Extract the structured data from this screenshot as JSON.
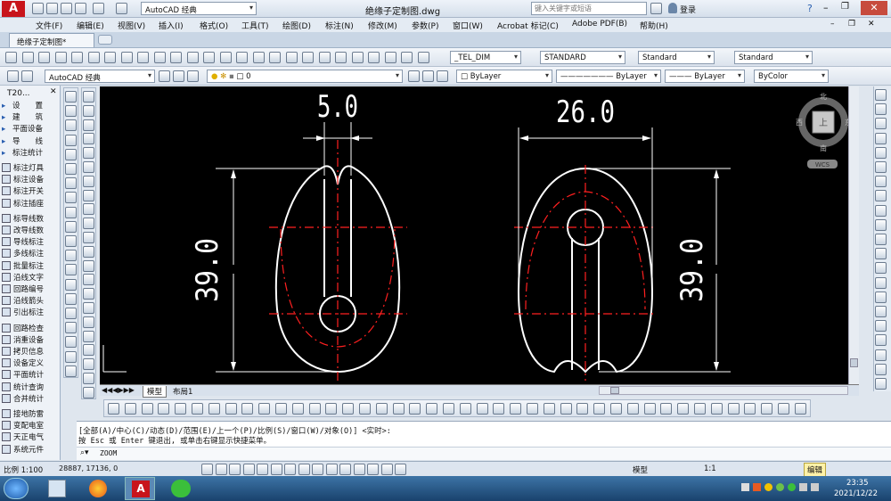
{
  "title_bar": {
    "workspace": "AutoCAD 经典",
    "file_title": "绝缘子定制图.dwg",
    "search_placeholder": "键入关键字或短语",
    "login": "登录"
  },
  "menu": [
    "文件(F)",
    "编辑(E)",
    "视图(V)",
    "插入(I)",
    "格式(O)",
    "工具(T)",
    "绘图(D)",
    "标注(N)",
    "修改(M)",
    "参数(P)",
    "窗口(W)",
    "Acrobat 标记(C)",
    "Adobe PDF(B)",
    "帮助(H)"
  ],
  "doc_tab": "绝缘子定制图*",
  "styles": {
    "dim_style": "_TEL_DIM",
    "text_style": "STANDARD",
    "table_style": "Standard",
    "multileader_style": "Standard"
  },
  "layers": {
    "workspace": "AutoCAD 经典",
    "layer": "0",
    "color": "ByLayer",
    "linetype": "ByLayer",
    "lineweight": "ByLayer",
    "plot": "ByColor"
  },
  "tangent_panel": {
    "title": "T20...",
    "items": [
      "设　　置",
      "建　　筑",
      "平面设备",
      "导　　线",
      "标注统计",
      "标注灯具",
      "标注设备",
      "标注开关",
      "标注插座",
      "标导线数",
      "改导线数",
      "导线标注",
      "多线标注",
      "批量标注",
      "沿线文字",
      "回路编号",
      "沿线箭头",
      "引出标注",
      "回路检查",
      "消重设备",
      "拷贝信息",
      "设备定义",
      "平面统计",
      "统计查询",
      "合并统计",
      "接地防雷",
      "变配电室",
      "天正电气",
      "系统元件"
    ]
  },
  "drawing": {
    "left_width_dim": "5.0",
    "left_height_dim": "39.0",
    "right_width_dim": "26.0",
    "right_height_dim": "39.0",
    "line_color": "#ffffff",
    "center_color": "#ff2020"
  },
  "viewcube": {
    "north": "北",
    "south": "南",
    "east": "东",
    "west": "西",
    "top": "上",
    "wcs": "WCS"
  },
  "layout_tabs": [
    "模型",
    "布局1"
  ],
  "command": {
    "line1": "[全部(A)/中心(C)/动态(D)/范围(E)/上一个(P)/比例(S)/窗口(W)/对象(O)] <实时>:",
    "line2": "按 Esc 或 Enter 键退出, 或单击右键显示快捷菜单。",
    "prompt": "ZOOM"
  },
  "status": {
    "scale": "比例 1:100",
    "coords": "28887, 17136, 0",
    "model": "模型",
    "annotation_scale": "1:1",
    "workspace": "编辑"
  },
  "taskbar": {
    "time": "23:35",
    "date": "2021/12/22"
  }
}
